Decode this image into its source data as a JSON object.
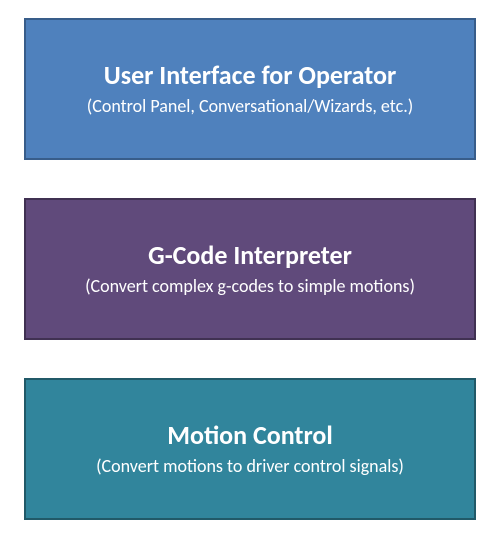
{
  "blocks": [
    {
      "title": "User Interface for Operator",
      "subtitle": "(Control Panel, Conversational/Wizards, etc.)"
    },
    {
      "title": "G-Code Interpreter",
      "subtitle": "(Convert complex g-codes to simple motions)"
    },
    {
      "title": "Motion Control",
      "subtitle": "(Convert motions to driver control signals)"
    }
  ]
}
